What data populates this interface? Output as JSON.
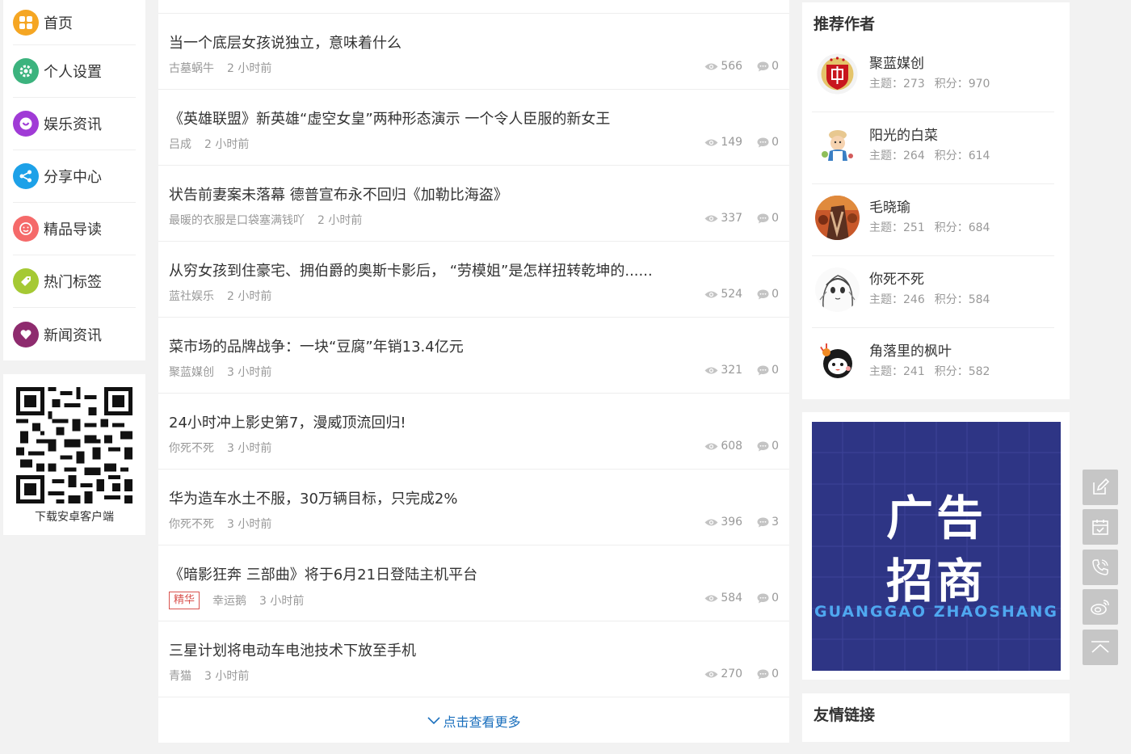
{
  "nav": {
    "items": [
      {
        "label": "首页",
        "icon": "home-grid-icon",
        "color": "#f5a623"
      },
      {
        "label": "个人设置",
        "icon": "gear-icon",
        "color": "#3cb37e"
      },
      {
        "label": "娱乐资讯",
        "icon": "smile-icon",
        "color": "#a03bd6"
      },
      {
        "label": "分享中心",
        "icon": "share-icon",
        "color": "#1da1e8"
      },
      {
        "label": "精品导读",
        "icon": "face-icon",
        "color": "#f56a6a"
      },
      {
        "label": "热门标签",
        "icon": "tag-icon",
        "color": "#a5c934"
      },
      {
        "label": "新闻资讯",
        "icon": "heart-icon",
        "color": "#8e2b6e"
      }
    ]
  },
  "qr": {
    "caption": "下载安卓客户端"
  },
  "articles": [
    {
      "title": "当一个底层女孩说独立，意味着什么",
      "author": "古墓蜗牛",
      "time": "2 小时前",
      "views": "566",
      "comments": "0",
      "badge": ""
    },
    {
      "title": "《英雄联盟》新英雄“虚空女皇”两种形态演示 一个令人臣服的新女王",
      "author": "吕成",
      "time": "2 小时前",
      "views": "149",
      "comments": "0",
      "badge": ""
    },
    {
      "title": "状告前妻案未落幕 德普宣布永不回归《加勒比海盗》",
      "author": "最暖的衣服是口袋塞满钱吖",
      "time": "2 小时前",
      "views": "337",
      "comments": "0",
      "badge": ""
    },
    {
      "title": "从穷女孩到住豪宅、拥伯爵的奥斯卡影后， “劳模姐”是怎样扭转乾坤的......",
      "author": "蓝社娱乐",
      "time": "2 小时前",
      "views": "524",
      "comments": "0",
      "badge": ""
    },
    {
      "title": "菜市场的品牌战争：一块“豆腐”年销13.4亿元",
      "author": "聚蓝媒创",
      "time": "3 小时前",
      "views": "321",
      "comments": "0",
      "badge": ""
    },
    {
      "title": "24小时冲上影史第7，漫威顶流回归!",
      "author": "你死不死",
      "time": "3 小时前",
      "views": "608",
      "comments": "0",
      "badge": ""
    },
    {
      "title": "华为造车水土不服，30万辆目标，只完成2%",
      "author": "你死不死",
      "time": "3 小时前",
      "views": "396",
      "comments": "3",
      "badge": ""
    },
    {
      "title": "《暗影狂奔 三部曲》将于6月21日登陆主机平台",
      "author": "幸运鹅",
      "time": "3 小时前",
      "views": "584",
      "comments": "0",
      "badge": "精华"
    },
    {
      "title": "三星计划将电动车电池技术下放至手机",
      "author": "青猫",
      "time": "3 小时前",
      "views": "270",
      "comments": "0",
      "badge": ""
    }
  ],
  "load_more": "点击查看更多",
  "authors": {
    "title": "推荐作者",
    "list": [
      {
        "name": "聚蓝媒创",
        "topics_label": "主题：273",
        "score_label": "积分：970",
        "avatar": "red-shield-avatar"
      },
      {
        "name": "阳光的白菜",
        "topics_label": "主题：264",
        "score_label": "积分：614",
        "avatar": "cartoon-chef-avatar"
      },
      {
        "name": "毛晓瑜",
        "topics_label": "主题：251",
        "score_label": "积分：684",
        "avatar": "photo-avatar"
      },
      {
        "name": "你死不死",
        "topics_label": "主题：246",
        "score_label": "积分：584",
        "avatar": "sketch-girl-avatar"
      },
      {
        "name": "角落里的枫叶",
        "topics_label": "主题：241",
        "score_label": "积分：582",
        "avatar": "cartoon-face-avatar"
      }
    ]
  },
  "ad": {
    "line1": "广告",
    "line2": "招商",
    "line3": "GUANGGAO ZHAOSHANG"
  },
  "links": {
    "title": "友情链接"
  },
  "tools": [
    "edit-icon",
    "calendar-icon",
    "phone-icon",
    "weibo-icon",
    "back-to-top-icon"
  ]
}
